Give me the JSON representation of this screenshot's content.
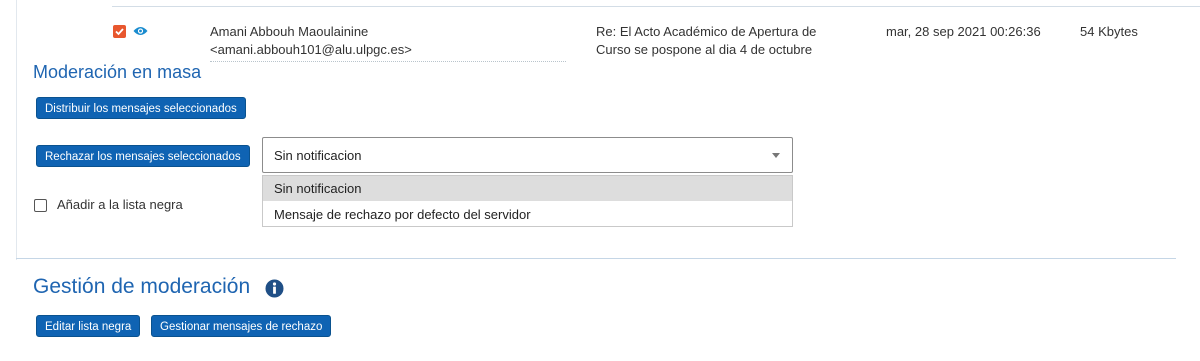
{
  "message": {
    "sender_name": "Amani Abbouh Maoulainine",
    "sender_email": "<amani.abbouh101@alu.ulpgc.es>",
    "subject": "Re: El Acto Académico de Apertura de Curso se pospone al dia 4 de octubre",
    "date": "mar, 28 sep 2021 00:26:36",
    "size": "54 Kbytes",
    "selected": true
  },
  "mass_moderation": {
    "title": "Moderación en masa",
    "distribute_button": "Distribuir los mensajes seleccionados",
    "reject_button": "Rechazar los mensajes seleccionados",
    "reject_select": {
      "selected": "Sin notificacion",
      "options": [
        "Sin notificacion",
        "Mensaje de rechazo por defecto del servidor"
      ],
      "expanded": true
    },
    "blacklist_checkbox": {
      "label": "Añadir a la lista negra",
      "checked": false
    }
  },
  "moderation_management": {
    "title": "Gestión de moderación",
    "edit_blacklist_button": "Editar lista negra",
    "manage_reject_button": "Gestionar mensajes de rechazo"
  },
  "colors": {
    "accent": "#0f63b3",
    "heading": "#1f65b1",
    "checkbox_checked": "#e8572e"
  },
  "icons": [
    "check-icon",
    "eye-icon",
    "info-icon",
    "dropdown-arrow-icon"
  ]
}
